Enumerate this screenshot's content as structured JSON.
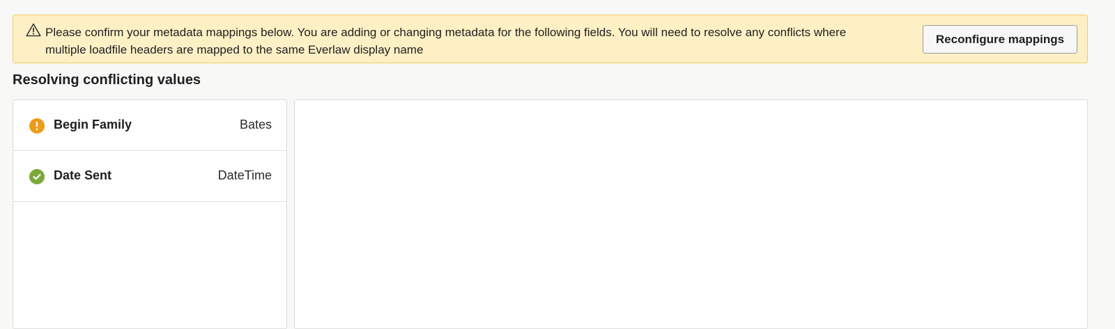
{
  "banner": {
    "message": "Please confirm your metadata mappings below. You are adding or changing metadata for the following fields. You will need to resolve any conflicts where multiple loadfile headers are mapped to the same Everlaw display name",
    "button_label": "Reconfigure mappings",
    "icon": "warning-triangle-icon"
  },
  "section": {
    "title": "Resolving conflicting values"
  },
  "fields": [
    {
      "name": "Begin Family",
      "type": "Bates",
      "status": "warning",
      "status_icon": "exclamation-circle-icon",
      "status_color": "#ee9a1a"
    },
    {
      "name": "Date Sent",
      "type": "DateTime",
      "status": "resolved",
      "status_icon": "check-circle-icon",
      "status_color": "#7aa83a"
    }
  ],
  "colors": {
    "banner_background": "#fdf0c5",
    "banner_border": "#f0cd6a",
    "warning": "#ee9a1a",
    "success": "#7aa83a"
  }
}
